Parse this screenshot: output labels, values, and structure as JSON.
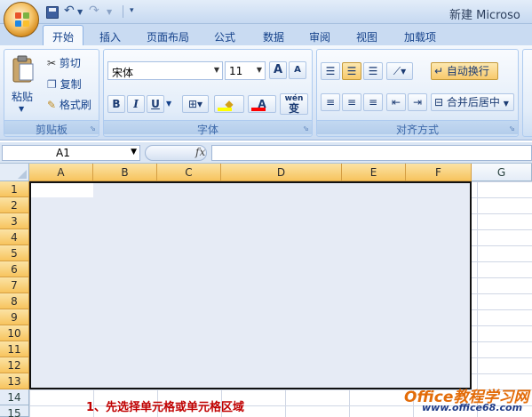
{
  "title_bar": {
    "window_title": "新建 Microso"
  },
  "quick_access": {
    "save_icon": "save-icon",
    "undo_icon": "undo-icon",
    "redo_icon": "redo-icon"
  },
  "tabs": [
    {
      "label": "开始",
      "active": true
    },
    {
      "label": "插入",
      "active": false
    },
    {
      "label": "页面布局",
      "active": false
    },
    {
      "label": "公式",
      "active": false
    },
    {
      "label": "数据",
      "active": false
    },
    {
      "label": "审阅",
      "active": false
    },
    {
      "label": "视图",
      "active": false
    },
    {
      "label": "加载项",
      "active": false
    }
  ],
  "ribbon": {
    "clipboard": {
      "label": "剪贴板",
      "paste": "粘贴",
      "cut": "剪切",
      "copy": "复制",
      "format_painter": "格式刷"
    },
    "font": {
      "label": "字体",
      "font_name": "宋体",
      "font_size": "11",
      "bold": "B",
      "italic": "I",
      "underline": "U",
      "grow": "A",
      "shrink": "A",
      "font_color_letter": "A",
      "phonetic": "wén",
      "phonetic_char": "变"
    },
    "alignment": {
      "label": "对齐方式",
      "wrap_text": "自动换行",
      "merge_center": "合并后居中"
    }
  },
  "formula_bar": {
    "name_box": "A1",
    "fx": "fx",
    "content": ""
  },
  "sheet": {
    "columns": [
      "A",
      "B",
      "C",
      "D",
      "E",
      "F",
      "G"
    ],
    "rows": [
      "1",
      "2",
      "3",
      "4",
      "5",
      "6",
      "7",
      "8",
      "9",
      "10",
      "11",
      "12",
      "13",
      "14",
      "15"
    ],
    "selected_columns": [
      "A",
      "B",
      "C",
      "D",
      "E",
      "F"
    ],
    "selected_rows": [
      "1",
      "2",
      "3",
      "4",
      "5",
      "6",
      "7",
      "8",
      "9",
      "10",
      "11",
      "12",
      "13"
    ]
  },
  "annotation": "1、先选择单元格或单元格区域",
  "watermark": {
    "line1": "Office教程学习网",
    "line2": "www.office68.com"
  },
  "colors": {
    "selection_fill": "#e6ebf5",
    "header_highlight": "#f7c45e",
    "annotation": "#c00000",
    "watermark_orange": "#e36c09"
  }
}
